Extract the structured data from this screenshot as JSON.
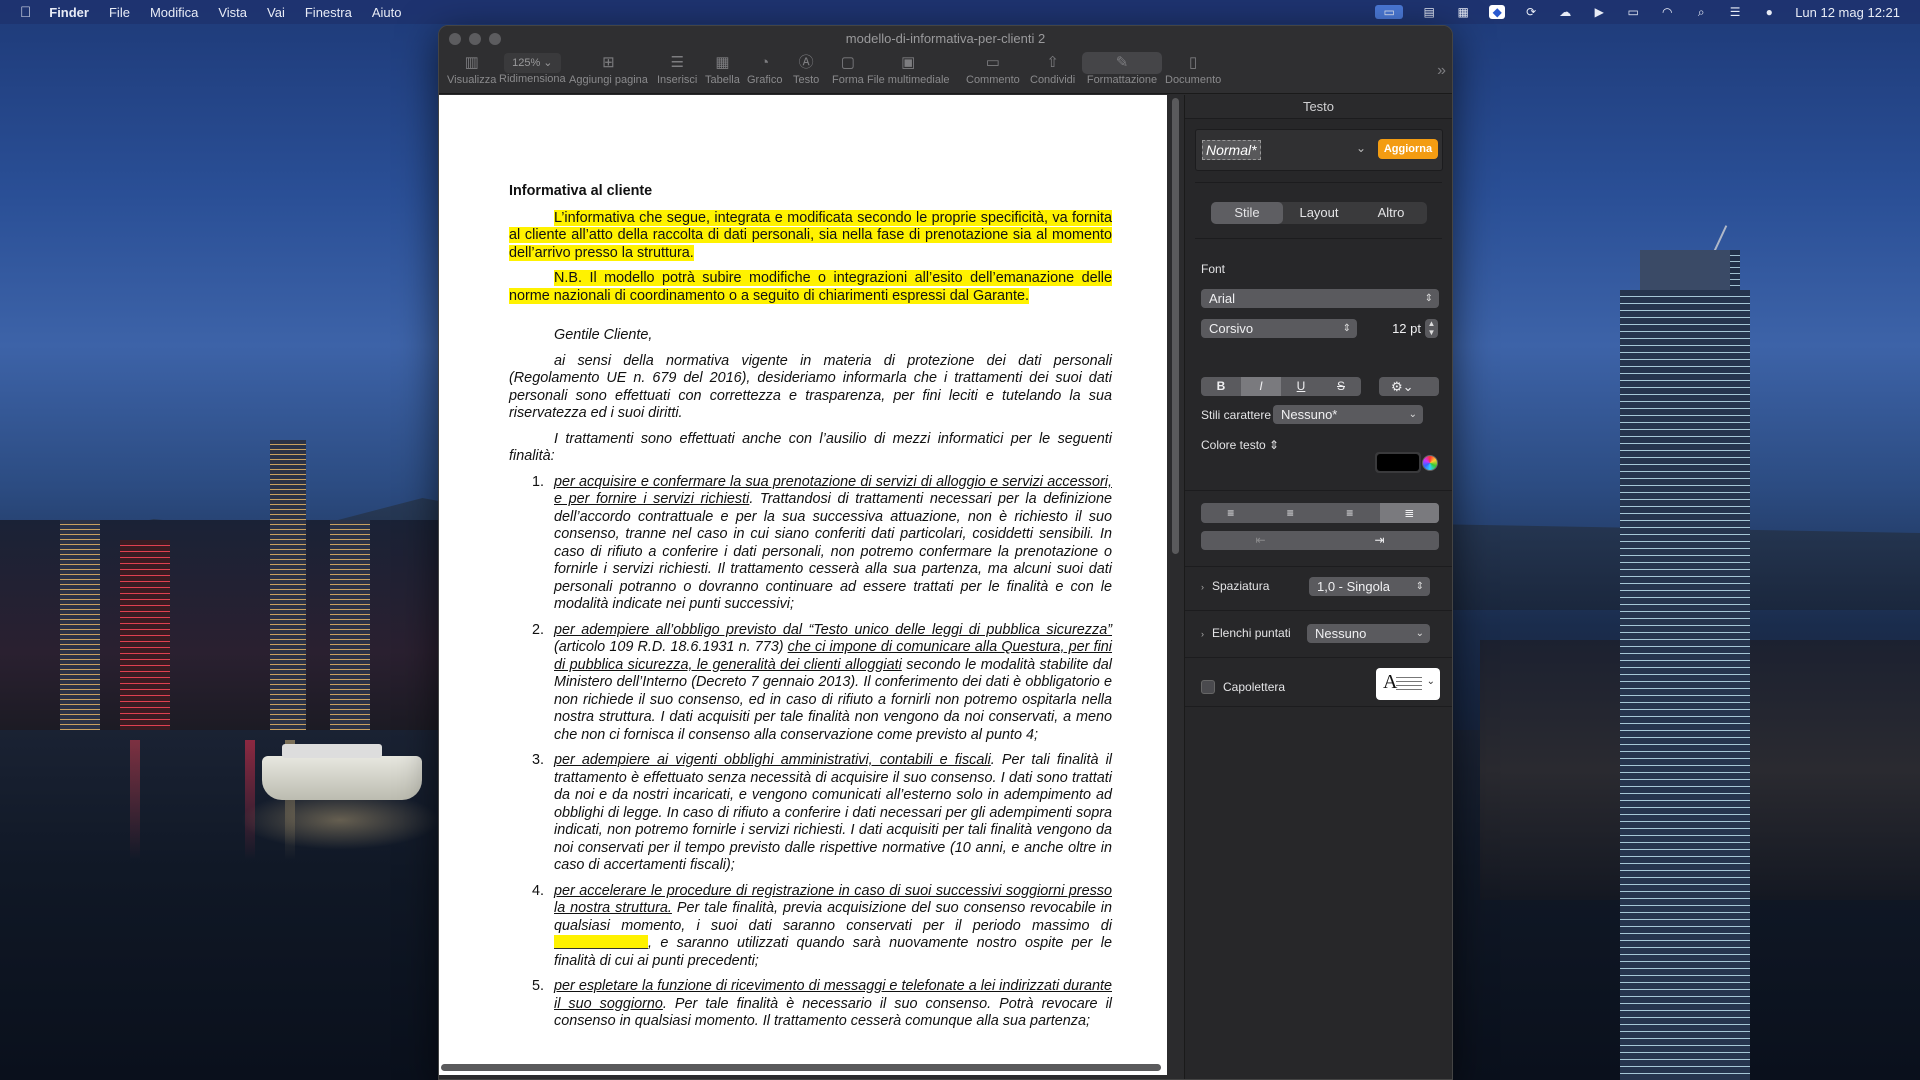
{
  "menubar": {
    "apple_icon": "apple-icon",
    "items": [
      "Finder",
      "File",
      "Modifica",
      "Vista",
      "Vai",
      "Finestra",
      "Aiuto"
    ],
    "clock": "Lun 12 mag  12:21"
  },
  "window": {
    "title": "modello-di-informativa-per-clienti 2"
  },
  "toolbar": {
    "visualizza": "Visualizza",
    "zoom_value": "125% ⌄",
    "ridimensiona": "Ridimensiona",
    "aggiungi_pagina": "Aggiungi pagina",
    "inserisci": "Inserisci",
    "tabella": "Tabella",
    "grafico": "Grafico",
    "testo": "Testo",
    "forma": "Forma",
    "file_multimediale": "File multimediale",
    "commento": "Commento",
    "condividi": "Condividi",
    "formattazione": "Formattazione",
    "documento": "Documento"
  },
  "document": {
    "title": "Informativa al cliente",
    "intro1": "L’informativa che segue, integrata e modificata secondo le proprie specificità, va fornita al cliente all’atto della raccolta di dati personali, sia nella fase di prenotazione sia al momento dell’arrivo presso la struttura.",
    "intro2": "N.B. Il modello potrà subire modifiche o integrazioni all’esito dell’emanazione delle norme nazionali di coordinamento o a seguito di chiarimenti espressi dal Garante.",
    "greeting": "Gentile Cliente,",
    "body1": "ai sensi della normativa vigente in materia di protezione dei dati personali (Regolamento UE n. 679 del 2016), desideriamo informarla che i trattamenti dei suoi dati personali sono effettuati con correttezza e trasparenza, per fini leciti e tutelando la sua riservatezza ed i suoi diritti.",
    "body2": "I trattamenti sono effettuati anche con l’ausilio di mezzi informatici per le seguenti finalità:",
    "items": [
      {
        "num": "1.",
        "u1": "per acquisire e confermare la sua prenotazione di servizi di alloggio e servizi accessori, e per fornire i servizi richiesti",
        "t1": ". Trattandosi di trattamenti necessari per la definizione dell’accordo contrattuale e per la sua successiva attuazione, non è richiesto il suo consenso, tranne nel caso in cui siano conferiti dati particolari, cosiddetti sensibili. In caso di rifiuto a conferire i dati personali, non potremo confermare la prenotazione o fornirle i servizi richiesti. Il trattamento cesserà alla sua partenza, ma alcuni suoi dati personali potranno o dovranno continuare ad essere trattati per le finalità e con le modalità indicate nei punti successivi;"
      },
      {
        "num": "2.",
        "u1": "per adempiere all’obbligo previsto dal “Testo unico delle leggi di pubblica sicurezza”",
        "t1": " (articolo 109 R.D. 18.6.1931 n. 773) ",
        "u2": "che ci impone di comunicare alla Questura, per fini di pubblica sicurezza, le generalità dei clienti alloggiati",
        "t2": " secondo le modalità stabilite dal Ministero dell’Interno (Decreto 7 gennaio 2013). Il conferimento dei dati è obbligatorio e non richiede il suo consenso, ed in caso di rifiuto a fornirli non potremo ospitarla nella nostra struttura. I dati acquisiti per tale finalità non vengono da noi conservati, a meno che non ci fornisca il consenso alla conservazione come previsto al punto 4;"
      },
      {
        "num": "3.",
        "u1": "per adempiere ai vigenti obblighi amministrativi, contabili e fiscali",
        "t1": ". Per tali finalità il trattamento è effettuato senza necessità di acquisire il suo consenso. I dati sono trattati da noi e da nostri incaricati, e vengono comunicati all’esterno solo in adempimento ad obblighi di legge. In caso di rifiuto a conferire i dati necessari per gli adempimenti sopra indicati, non potremo fornirle i servizi richiesti. I dati acquisiti per tali finalità vengono da noi conservati per il tempo previsto dalle rispettive normative (10 anni, e anche oltre in caso di accertamenti fiscali);"
      },
      {
        "num": "4.",
        "u1": "per accelerare le procedure di registrazione in caso di suoi successivi soggiorni presso la nostra struttura.",
        "t1": " Per tale finalità, previa acquisizione del suo consenso revocabile in qualsiasi momento, i suoi dati saranno conservati per il periodo massimo di ",
        "t2": ", e saranno utilizzati quando sarà nuovamente nostro ospite per le finalità di cui ai punti precedenti;"
      },
      {
        "num": "5.",
        "u1": "per espletare la funzione di ricevimento di messaggi e telefonate a lei indirizzati durante il suo soggiorno",
        "t1": ". Per tale finalità è necessario il suo consenso. Potrà revocare il consenso in qualsiasi momento. Il trattamento cesserà comunque alla sua partenza;"
      }
    ]
  },
  "inspector": {
    "header": "Testo",
    "style_name": "Normal*",
    "update_button": "Aggiorna",
    "tabs": [
      "Stile",
      "Layout",
      "Altro"
    ],
    "font_label": "Font",
    "font_family": "Arial",
    "font_style": "Corsivo",
    "font_size": "12 pt",
    "bius": [
      "B",
      "I",
      "U",
      "S"
    ],
    "options_glyph": "⚙⌄",
    "char_styles_label": "Stili carattere",
    "char_styles_value": "Nessuno*",
    "text_color_label": "Colore testo ⇕",
    "text_color": "#000000",
    "spacing_label": "Spaziatura",
    "spacing_value": "1,0 - Singola",
    "bullets_label": "Elenchi puntati",
    "bullets_value": "Nessuno",
    "dropcap_label": "Capolettera"
  }
}
